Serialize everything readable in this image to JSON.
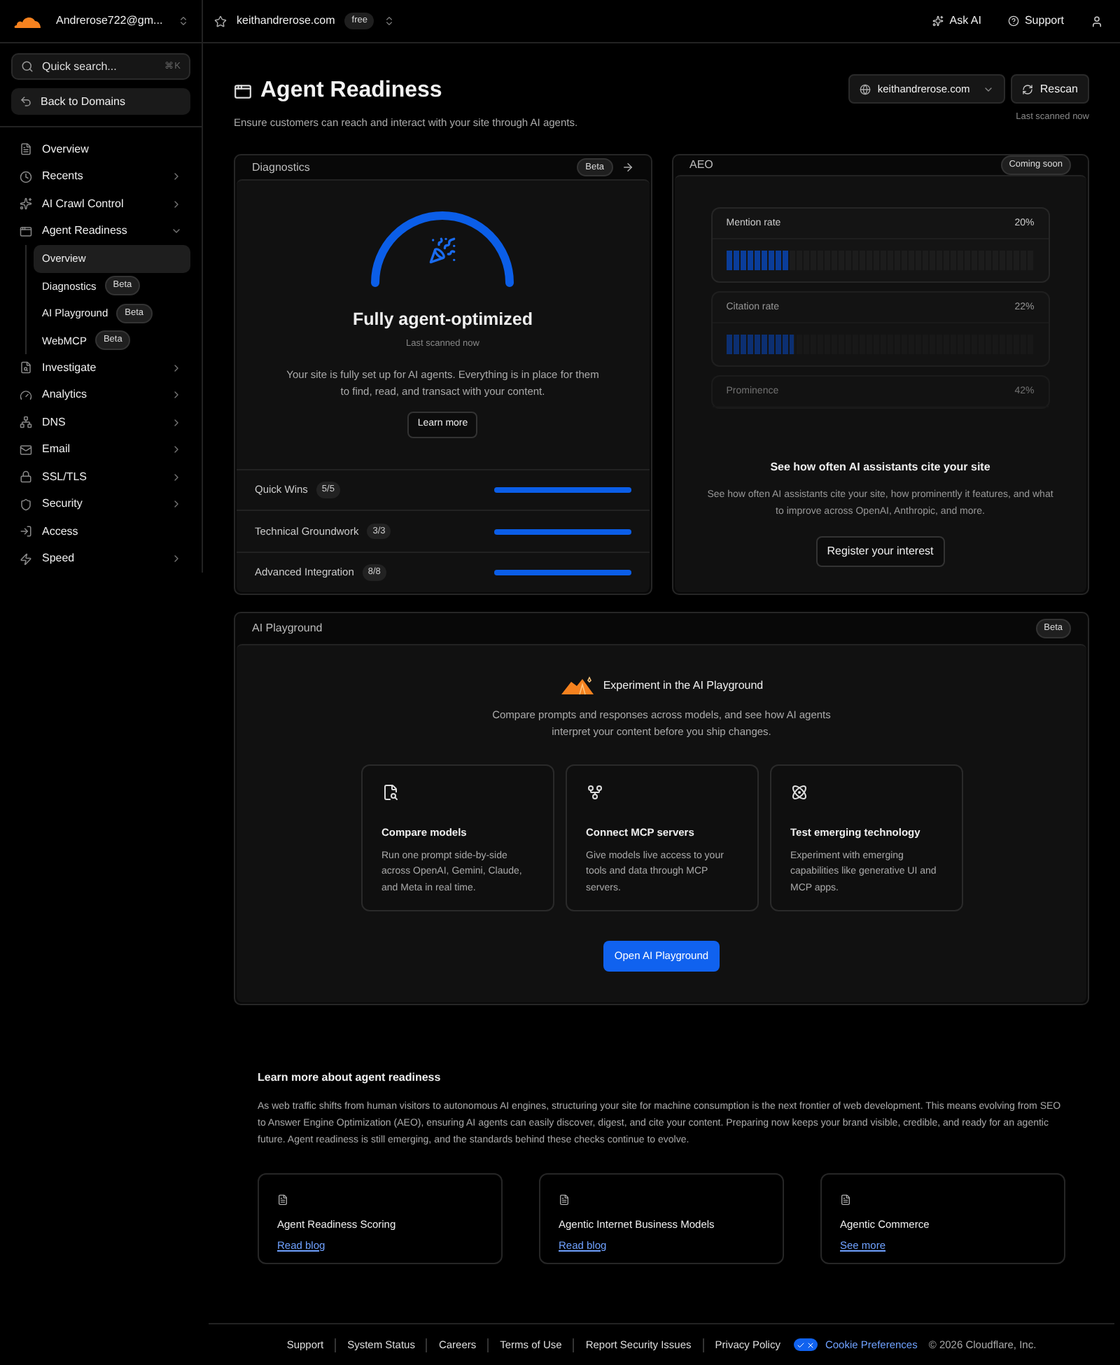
{
  "account": {
    "name": "Andrerose722@gm..."
  },
  "zone": {
    "domain": "keithandrerose.com",
    "plan": "free"
  },
  "top_actions": [
    {
      "kind": "ask",
      "label": "Ask AI"
    },
    {
      "kind": "support",
      "label": "Support"
    }
  ],
  "sidebar": {
    "search": {
      "placeholder": "Quick search...",
      "shortcut": "⌘K"
    },
    "back": "Back to Domains",
    "items": [
      {
        "label": "Overview",
        "selected": false
      },
      {
        "label": "Recents",
        "expanded": false,
        "selected": false
      },
      {
        "label": "AI Crawl Control",
        "expanded": false,
        "selected": false
      },
      {
        "label": "Agent Readiness",
        "expanded": true,
        "selected": false,
        "children": [
          {
            "label": "Overview",
            "selected": true
          },
          {
            "label": "Diagnostics",
            "badge": "Beta",
            "selected": false
          },
          {
            "label": "AI Playground",
            "badge": "Beta",
            "selected": false
          },
          {
            "label": "WebMCP",
            "badge": "Beta",
            "selected": false
          }
        ]
      },
      {
        "label": "Investigate",
        "expanded": false,
        "selected": false
      },
      {
        "label": "Analytics",
        "expanded": false,
        "selected": false
      },
      {
        "label": "DNS",
        "expanded": false,
        "selected": false
      },
      {
        "label": "Email",
        "expanded": false,
        "selected": false
      },
      {
        "label": "SSL/TLS",
        "expanded": false,
        "selected": false
      },
      {
        "label": "Security",
        "expanded": false,
        "selected": false
      },
      {
        "label": "Access",
        "selected": false
      },
      {
        "label": "Speed",
        "expanded": false,
        "selected": false
      }
    ]
  },
  "page": {
    "title": "Agent Readiness",
    "subtitle": "Ensure customers can reach and interact with your site through AI agents.",
    "domain_select": "keithandrerose.com",
    "rescan": "Rescan",
    "last_scanned": "Last scanned now"
  },
  "diagnostics": {
    "title": "Diagnostics",
    "badge": "Beta",
    "status": "Fully agent-optimized",
    "scanned": "Last scanned now",
    "description": "Your site is fully set up for AI agents. Everything is in place for them to find, read, and transact with your content.",
    "learn_more": "Learn more",
    "rows": [
      {
        "label": "Quick Wins",
        "count": "5/5",
        "level": 1
      },
      {
        "label": "Technical Groundwork",
        "count": "3/3",
        "level": 1
      },
      {
        "label": "Advanced Integration",
        "count": "8/8",
        "level": 1
      }
    ]
  },
  "aeo": {
    "title": "AEO",
    "badge": "Coming soon",
    "metrics": [
      {
        "label": "Mention rate",
        "value": "20%",
        "level": 0.2
      },
      {
        "label": "Citation rate",
        "value": "22%",
        "level": 0.22
      },
      {
        "label": "Prominence",
        "value": "42%"
      }
    ],
    "heading": "See how often AI assistants cite your site",
    "description": "See how often AI assistants cite your site, how prominently it features, and what to improve across OpenAI, Anthropic, and more.",
    "button": "Register your interest"
  },
  "playground": {
    "title": "AI Playground",
    "badge": "Beta",
    "heading": "Experiment in the AI Playground",
    "description": "Compare prompts and responses across models, and see how AI agents interpret your content before you ship changes.",
    "features": [
      {
        "title": "Compare models",
        "text": "Run one prompt side-by-side across OpenAI, Gemini, Claude, and Meta in real time."
      },
      {
        "title": "Connect MCP servers",
        "text": "Give models live access to your tools and data through MCP servers."
      },
      {
        "title": "Test emerging technology",
        "text": "Experiment with emerging capabilities like generative UI and MCP apps."
      }
    ],
    "button": "Open AI Playground"
  },
  "learn": {
    "title": "Learn more about agent readiness",
    "text": "As web traffic shifts from human visitors to autonomous AI engines, structuring your site for machine consumption is the next frontier of web development. This means evolving from SEO to Answer Engine Optimization (AEO), ensuring AI agents can easily discover, digest, and cite your content. Preparing now keeps your brand visible, credible, and ready for an agentic future. Agent readiness is still emerging, and the standards behind these checks continue to evolve.",
    "cards": [
      {
        "title": "Agent Readiness Scoring",
        "link": "Read blog"
      },
      {
        "title": "Agentic Internet Business Models",
        "link": "Read blog"
      },
      {
        "title": "Agentic Commerce",
        "link": "See more"
      }
    ]
  },
  "footer": {
    "links": [
      "Support",
      "System Status",
      "Careers",
      "Terms of Use",
      "Report Security Issues",
      "Privacy Policy"
    ],
    "cookie": {
      "label": "Cookie Preferences",
      "on": true
    },
    "copyright": "© 2026 Cloudflare, Inc."
  }
}
